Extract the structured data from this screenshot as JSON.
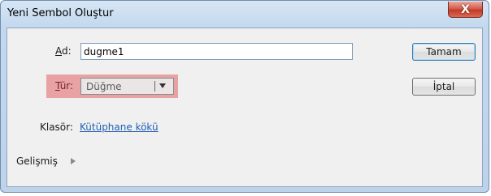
{
  "window": {
    "title": "Yeni Sembol Oluştur",
    "close_glyph": "X"
  },
  "form": {
    "name_label": "Ad:",
    "name_label_accel": "A",
    "name_label_rest": "d:",
    "name_value": "dugme1",
    "type_label_accel": "T",
    "type_label_rest": "ür:",
    "type_value": "Düğme",
    "folder_label": "Klasör:",
    "folder_link": "Kütüphane kökü",
    "advanced_label": "Gelişmiş"
  },
  "buttons": {
    "ok": "Tamam",
    "cancel": "İptal"
  },
  "colors": {
    "type_highlight": "#e8a2a4",
    "close_button": "#c23a28",
    "link": "#1f5fb4"
  }
}
